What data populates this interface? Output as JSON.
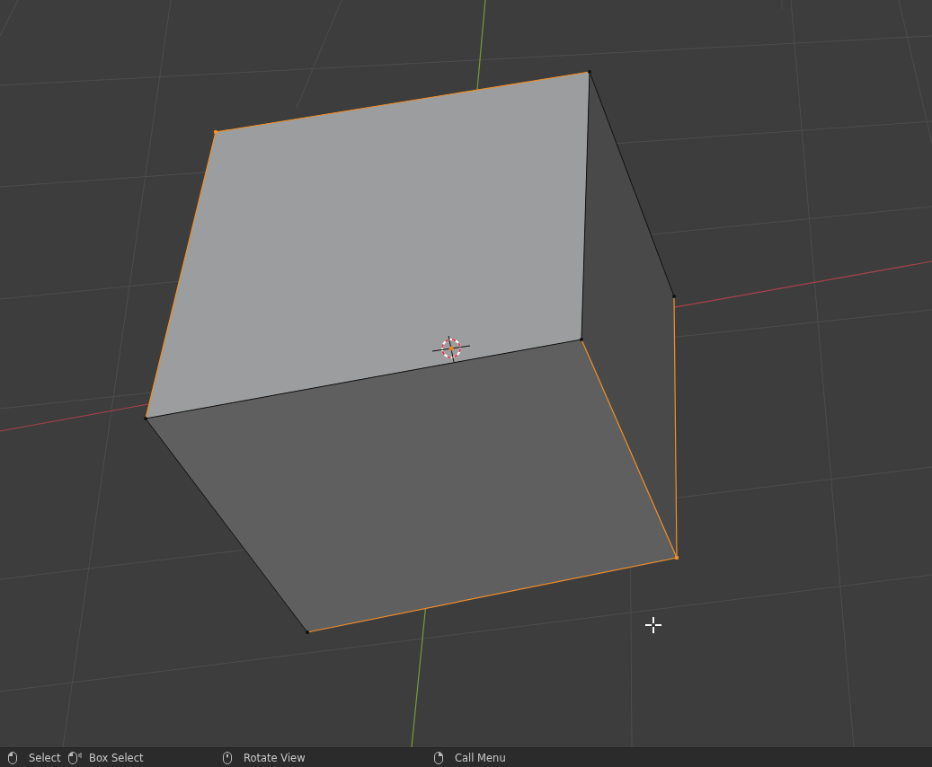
{
  "status_bar": {
    "items": [
      {
        "kind": "left-click",
        "label": "Select"
      },
      {
        "kind": "left-drag",
        "label": "Box Select"
      },
      {
        "kind": "middle-click",
        "label": "Rotate View"
      },
      {
        "kind": "right-click",
        "label": "Call Menu"
      }
    ]
  }
}
